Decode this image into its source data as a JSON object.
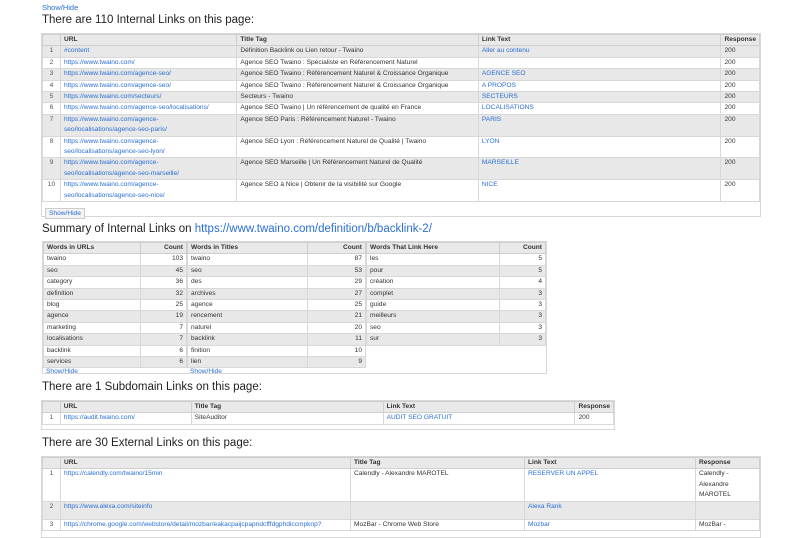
{
  "top_showhide": "Show/Hide",
  "internal": {
    "heading": "There are 110 Internal Links on this page:",
    "headers": [
      "URL",
      "Title Tag",
      "Link Text",
      "Response"
    ],
    "rows": [
      {
        "n": "1",
        "url": [
          "#content"
        ],
        "title": "Définition Backlink ou Lien retour - Twaino",
        "text": "Aller au contenu",
        "resp": "200"
      },
      {
        "n": "2",
        "url": [
          "https://www.twaino.com/"
        ],
        "title": "Agence SEO Twaino : Spécialiste en Référencement Naturel",
        "text": "",
        "resp": "200"
      },
      {
        "n": "3",
        "url": [
          "https://www.twaino.com/agence-seo/"
        ],
        "title": "Agence SEO Twaino : Référencement Naturel & Croissance Organique",
        "text": "AGENCE SEO",
        "resp": "200"
      },
      {
        "n": "4",
        "url": [
          "https://www.twaino.com/agence-seo/"
        ],
        "title": "Agence SEO Twaino : Référencement Naturel & Croissance Organique",
        "text": "A PROPOS",
        "resp": "200"
      },
      {
        "n": "5",
        "url": [
          "https://www.twaino.com/secteurs/"
        ],
        "title": "Secteurs - Twaino",
        "text": "SECTEURS",
        "resp": "200"
      },
      {
        "n": "6",
        "url": [
          "https://www.twaino.com/agence-seo/localisations/"
        ],
        "title": "Agence SEO Twaino | Un référencement de qualité en France",
        "text": "LOCALISATIONS",
        "resp": "200"
      },
      {
        "n": "7",
        "url": [
          "https://www.twaino.com/agence-",
          "seo/localisations/agence-seo-paris/"
        ],
        "title": "Agence SEO Paris : Référencement Naturel - Twaino",
        "text": "PARIS",
        "resp": "200"
      },
      {
        "n": "8",
        "url": [
          "https://www.twaino.com/agence-",
          "seo/localisations/agence-seo-lyon/"
        ],
        "title": "Agence SEO Lyon : Référencement Naturel de Qualité | Twaino",
        "text": "LYON",
        "resp": "200"
      },
      {
        "n": "9",
        "url": [
          "https://www.twaino.com/agence-",
          "seo/localisations/agence-seo-marseille/"
        ],
        "title": "Agence SEO Marseille | Un Référencement Naturel de Qualité",
        "text": "MARSEILLE",
        "resp": "200"
      },
      {
        "n": "10",
        "url": [
          "https://www.twaino.com/agence-",
          "seo/localisations/agence-seo-nice/"
        ],
        "title": "Agence SEO à Nice | Obtenir de la visibilité sur Google",
        "text": "NICE",
        "resp": "200"
      }
    ],
    "showhide": "Show/Hide"
  },
  "summary": {
    "heading_prefix": "Summary of Internal Links on ",
    "heading_link": "https://www.twaino.com/definition/b/backlink-2/",
    "urls": {
      "h1": "Words in URLs",
      "h2": "Count",
      "rows": [
        [
          "twaino",
          "103"
        ],
        [
          "seo",
          "45"
        ],
        [
          "category",
          "36"
        ],
        [
          "definition",
          "32"
        ],
        [
          "blog",
          "25"
        ],
        [
          "agence",
          "19"
        ],
        [
          "marketing",
          "7"
        ],
        [
          "localisations",
          "7"
        ],
        [
          "backlink",
          "6"
        ],
        [
          "services",
          "6"
        ]
      ],
      "showhide": "Show/Hide"
    },
    "titles": {
      "h1": "Words in Titles",
      "h2": "Count",
      "rows": [
        [
          "twaino",
          "87"
        ],
        [
          "seo",
          "53"
        ],
        [
          "des",
          "29"
        ],
        [
          "archives",
          "27"
        ],
        [
          "agence",
          "25"
        ],
        [
          "rencement",
          "21"
        ],
        [
          "naturel",
          "20"
        ],
        [
          "backlink",
          "11"
        ],
        [
          "finition",
          "10"
        ],
        [
          "lien",
          "9"
        ]
      ],
      "showhide": "Show/Hide"
    },
    "linktext": {
      "h1": "Words That Link Here",
      "h2": "Count",
      "rows": [
        [
          "les",
          "5"
        ],
        [
          "pour",
          "5"
        ],
        [
          "création",
          "4"
        ],
        [
          "complet",
          "3"
        ],
        [
          "guide",
          "3"
        ],
        [
          "meilleurs",
          "3"
        ],
        [
          "seo",
          "3"
        ],
        [
          "sur",
          "3"
        ]
      ]
    }
  },
  "subdomain": {
    "heading": "There are 1 Subdomain Links on this page:",
    "headers": [
      "URL",
      "Title Tag",
      "Link Text",
      "Response"
    ],
    "rows": [
      {
        "n": "1",
        "url": "https://audit.twaino.com/",
        "title": "SiteAuditor",
        "text": "AUDIT SEO GRATUIT",
        "resp": "200"
      }
    ]
  },
  "external": {
    "heading": "There are 30 External Links on this page:",
    "headers": [
      "URL",
      "Title Tag",
      "Link Text",
      "Response"
    ],
    "rows": [
      {
        "n": "1",
        "url": "https://calendly.com/twaino/15min",
        "title": "Calendly - Alexandre MAROTEL",
        "text": "RESERVER UN APPEL",
        "resp": [
          "Calendly -",
          "Alexandre",
          "MAROTEL"
        ]
      },
      {
        "n": "2",
        "url": "https://www.alexa.com/siteinfo",
        "title": "",
        "text": "Alexa Rank",
        "resp": [
          ""
        ]
      },
      {
        "n": "3",
        "url": "https://chrome.google.com/webstore/detail/mozbar/eakacpaijcpapndcfffdgphdiccmpknp?",
        "title": "MozBar - Chrome Web Store",
        "text": "Mozbar",
        "resp": [
          "MozBar -"
        ]
      }
    ]
  }
}
